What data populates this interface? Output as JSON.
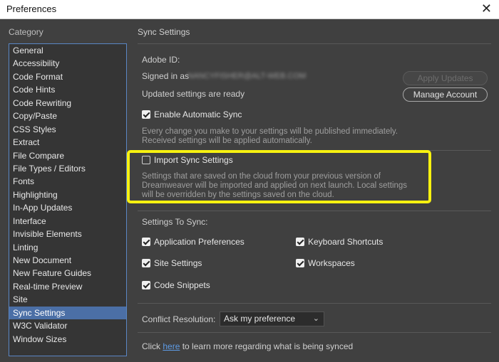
{
  "window": {
    "title": "Preferences",
    "close_glyph": "✕"
  },
  "sidebar": {
    "heading": "Category",
    "selected_index": 20,
    "items": [
      "General",
      "Accessibility",
      "Code Format",
      "Code Hints",
      "Code Rewriting",
      "Copy/Paste",
      "CSS Styles",
      "Extract",
      "File Compare",
      "File Types / Editors",
      "Fonts",
      "Highlighting",
      "In-App Updates",
      "Interface",
      "Invisible Elements",
      "Linting",
      "New Document",
      "New Feature Guides",
      "Real-time Preview",
      "Site",
      "Sync Settings",
      "W3C Validator",
      "Window Sizes"
    ]
  },
  "main": {
    "title": "Sync Settings",
    "adobe_id_label": "Adobe ID:",
    "signed_in_label": "Signed in as",
    "signed_in_value": "NANCYFISHER@ALT-WEB.COM",
    "updated_label": "Updated settings are ready",
    "apply_updates_label": "Apply Updates",
    "manage_account_label": "Manage Account",
    "enable_sync": {
      "label": "Enable Automatic Sync",
      "checked": true
    },
    "enable_sync_desc_1": "Every change you make to your settings will be published immediately.",
    "enable_sync_desc_2": "Received settings will be applied automatically.",
    "import_sync": {
      "label": "Import Sync Settings",
      "checked": false
    },
    "import_desc_1": "Settings that are saved on the cloud from your previous version of",
    "import_desc_2": "Dreamweaver will be imported and applied on next launch. Local settings",
    "import_desc_3": "will be overridden by the settings saved on the cloud.",
    "highlight_color": "#f7f110",
    "settings_to_sync_label": "Settings To Sync:",
    "sync_options": {
      "app_prefs": {
        "label": "Application Preferences",
        "checked": true
      },
      "keyboard": {
        "label": "Keyboard Shortcuts",
        "checked": true
      },
      "site": {
        "label": "Site Settings",
        "checked": true
      },
      "workspaces": {
        "label": "Workspaces",
        "checked": true
      },
      "snippets": {
        "label": "Code Snippets",
        "checked": true
      }
    },
    "conflict_label": "Conflict Resolution:",
    "conflict_value": "Ask my preference",
    "footer_pre": "Click ",
    "footer_link": "here",
    "footer_post": " to learn more regarding what is being synced"
  }
}
